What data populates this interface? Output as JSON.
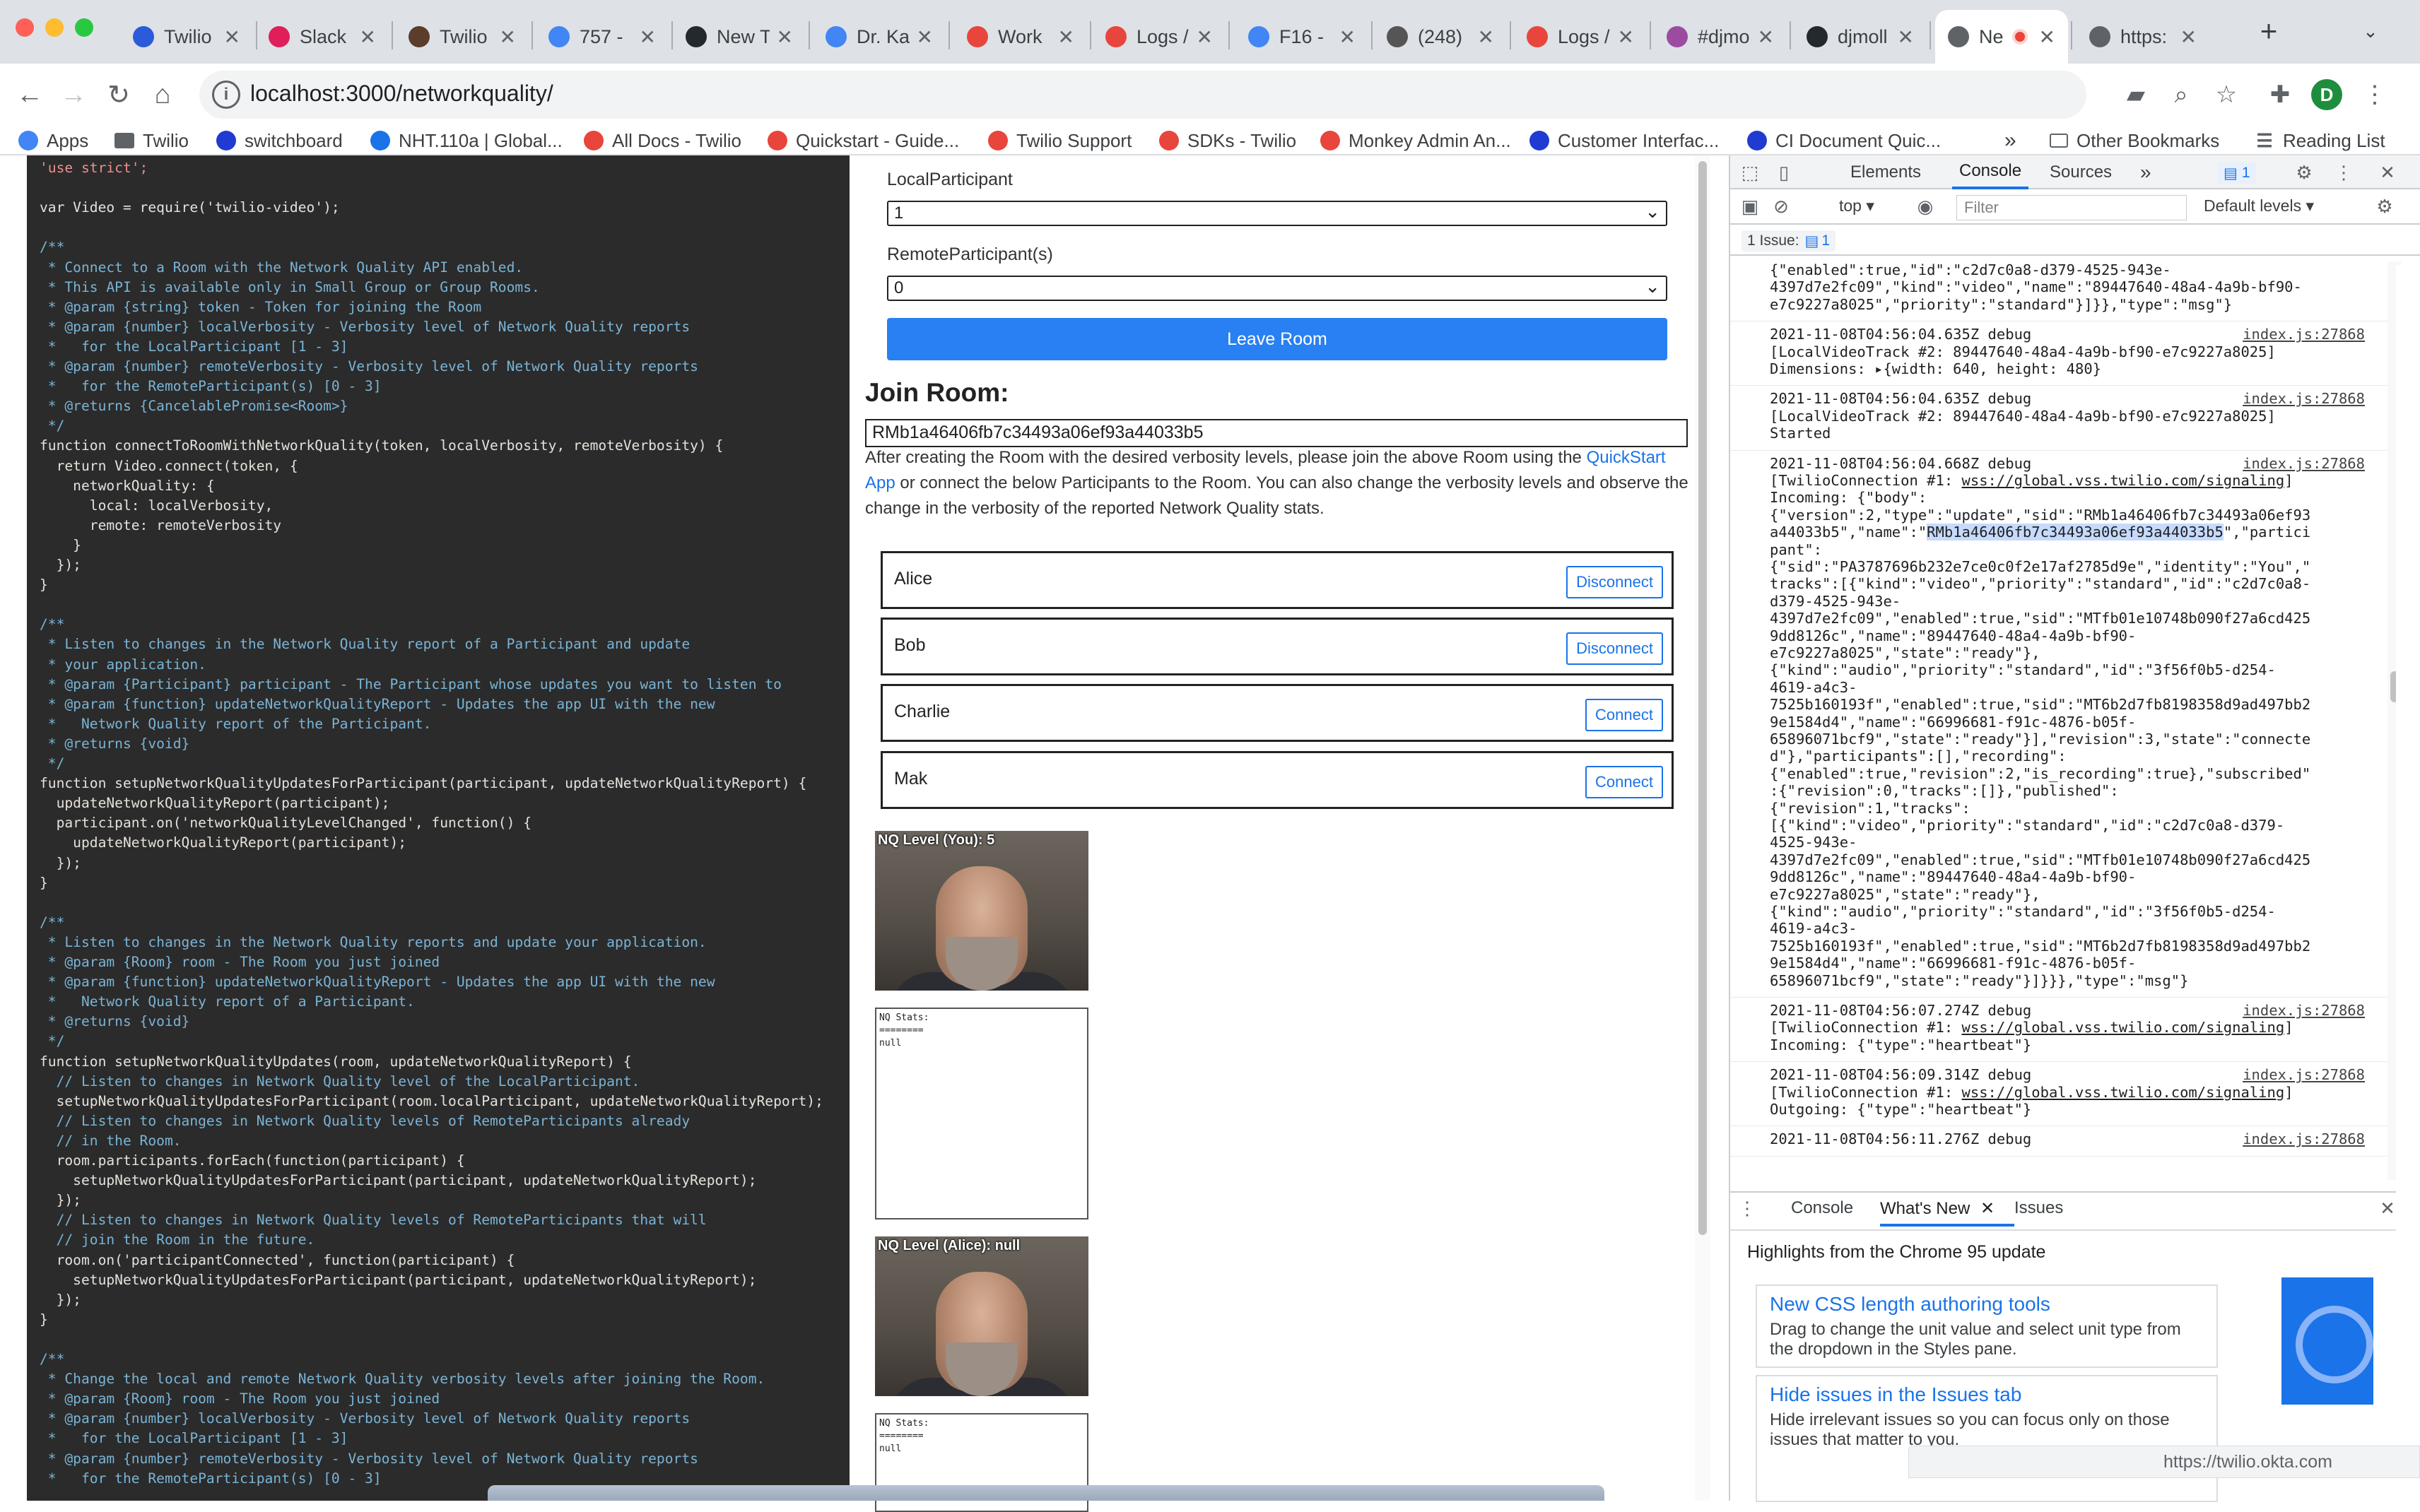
{
  "tabs": [
    {
      "label": "Twilio",
      "icon": "twilio-icon",
      "color": "#2b5bda"
    },
    {
      "label": "Slack",
      "icon": "slack-icon",
      "color": "#e01e5a"
    },
    {
      "label": "Twilio",
      "icon": "twilio-gnome-icon",
      "color": "#5a3d2b"
    },
    {
      "label": "757 -",
      "icon": "google-icon",
      "color": "#4285f4"
    },
    {
      "label": "New T",
      "icon": "github-icon",
      "color": "#24292e"
    },
    {
      "label": "Dr. Ka",
      "icon": "google-icon",
      "color": "#4285f4"
    },
    {
      "label": "Work",
      "icon": "monkey-icon",
      "color": "#e8453c"
    },
    {
      "label": "Logs /",
      "icon": "twilio-red-icon",
      "color": "#e8453c"
    },
    {
      "label": "F16 -",
      "icon": "google-icon",
      "color": "#4285f4"
    },
    {
      "label": "(248)",
      "icon": "speaker-icon",
      "color": "#555555"
    },
    {
      "label": "Logs /",
      "icon": "twilio-red-icon",
      "color": "#e8453c"
    },
    {
      "label": "#djmo",
      "icon": "slack-icon",
      "color": "#9c4ba0"
    },
    {
      "label": "djmoll",
      "icon": "github-icon",
      "color": "#24292e"
    },
    {
      "label": "Ne",
      "icon": "globe-icon",
      "color": "#5f6368"
    },
    {
      "label": "https:",
      "icon": "globe-icon",
      "color": "#5f6368"
    }
  ],
  "toolbar": {
    "url": "localhost:3000/networkquality/",
    "profile_initial": "D"
  },
  "bookmarks": [
    {
      "label": "Apps",
      "icon": "apps-grid-icon"
    },
    {
      "label": "Twilio",
      "icon": "folder-icon"
    },
    {
      "label": "switchboard",
      "icon": "twilio-icon"
    },
    {
      "label": "NHT.110a | Global...",
      "icon": "arrow-icon"
    },
    {
      "label": "All Docs - Twilio",
      "icon": "twilio-red-icon"
    },
    {
      "label": "Quickstart - Guide...",
      "icon": "twilio-red-icon"
    },
    {
      "label": "Twilio Support",
      "icon": "twilio-red-icon"
    },
    {
      "label": "SDKs - Twilio",
      "icon": "twilio-red-icon"
    },
    {
      "label": "Monkey Admin An...",
      "icon": "monkey-icon"
    },
    {
      "label": "Customer Interfac...",
      "icon": "twilio-icon"
    },
    {
      "label": "CI Document Quic...",
      "icon": "twilio-icon"
    }
  ],
  "bookmarks_overflow": "»",
  "bookmarks_right": [
    {
      "label": "Other Bookmarks",
      "icon": "folder-icon"
    },
    {
      "label": "Reading List",
      "icon": "reading-list-icon"
    }
  ],
  "code": [
    {
      "t": "'use strict';",
      "c": "st"
    },
    {
      "t": "",
      "c": ""
    },
    {
      "t": "var Video = require('twilio-video');",
      "c": "code"
    },
    {
      "t": "",
      "c": ""
    },
    {
      "t": "/**",
      "c": "cm"
    },
    {
      "t": " * Connect to a Room with the Network Quality API enabled.",
      "c": "cm"
    },
    {
      "t": " * This API is available only in Small Group or Group Rooms.",
      "c": "cm"
    },
    {
      "t": " * @param {string} token - Token for joining the Room",
      "c": "cm"
    },
    {
      "t": " * @param {number} localVerbosity - Verbosity level of Network Quality reports",
      "c": "cm"
    },
    {
      "t": " *   for the LocalParticipant [1 - 3]",
      "c": "cm"
    },
    {
      "t": " * @param {number} remoteVerbosity - Verbosity level of Network Quality reports",
      "c": "cm"
    },
    {
      "t": " *   for the RemoteParticipant(s) [0 - 3]",
      "c": "cm"
    },
    {
      "t": " * @returns {CancelablePromise<Room>}",
      "c": "cm"
    },
    {
      "t": " */",
      "c": "cm"
    },
    {
      "t": "function connectToRoomWithNetworkQuality(token, localVerbosity, remoteVerbosity) {",
      "c": "code"
    },
    {
      "t": "  return Video.connect(token, {",
      "c": "code"
    },
    {
      "t": "    networkQuality: {",
      "c": "code"
    },
    {
      "t": "      local: localVerbosity,",
      "c": "code"
    },
    {
      "t": "      remote: remoteVerbosity",
      "c": "code"
    },
    {
      "t": "    }",
      "c": "code"
    },
    {
      "t": "  });",
      "c": "code"
    },
    {
      "t": "}",
      "c": "code"
    },
    {
      "t": "",
      "c": ""
    },
    {
      "t": "/**",
      "c": "cm"
    },
    {
      "t": " * Listen to changes in the Network Quality report of a Participant and update",
      "c": "cm"
    },
    {
      "t": " * your application.",
      "c": "cm"
    },
    {
      "t": " * @param {Participant} participant - The Participant whose updates you want to listen to",
      "c": "cm"
    },
    {
      "t": " * @param {function} updateNetworkQualityReport - Updates the app UI with the new",
      "c": "cm"
    },
    {
      "t": " *   Network Quality report of the Participant.",
      "c": "cm"
    },
    {
      "t": " * @returns {void}",
      "c": "cm"
    },
    {
      "t": " */",
      "c": "cm"
    },
    {
      "t": "function setupNetworkQualityUpdatesForParticipant(participant, updateNetworkQualityReport) {",
      "c": "code"
    },
    {
      "t": "  updateNetworkQualityReport(participant);",
      "c": "code"
    },
    {
      "t": "  participant.on('networkQualityLevelChanged', function() {",
      "c": "code"
    },
    {
      "t": "    updateNetworkQualityReport(participant);",
      "c": "code"
    },
    {
      "t": "  });",
      "c": "code"
    },
    {
      "t": "}",
      "c": "code"
    },
    {
      "t": "",
      "c": ""
    },
    {
      "t": "/**",
      "c": "cm"
    },
    {
      "t": " * Listen to changes in the Network Quality reports and update your application.",
      "c": "cm"
    },
    {
      "t": " * @param {Room} room - The Room you just joined",
      "c": "cm"
    },
    {
      "t": " * @param {function} updateNetworkQualityReport - Updates the app UI with the new",
      "c": "cm"
    },
    {
      "t": " *   Network Quality report of a Participant.",
      "c": "cm"
    },
    {
      "t": " * @returns {void}",
      "c": "cm"
    },
    {
      "t": " */",
      "c": "cm"
    },
    {
      "t": "function setupNetworkQualityUpdates(room, updateNetworkQualityReport) {",
      "c": "code"
    },
    {
      "t": "  // Listen to changes in Network Quality level of the LocalParticipant.",
      "c": "cm"
    },
    {
      "t": "  setupNetworkQualityUpdatesForParticipant(room.localParticipant, updateNetworkQualityReport);",
      "c": "code"
    },
    {
      "t": "  // Listen to changes in Network Quality levels of RemoteParticipants already",
      "c": "cm"
    },
    {
      "t": "  // in the Room.",
      "c": "cm"
    },
    {
      "t": "  room.participants.forEach(function(participant) {",
      "c": "code"
    },
    {
      "t": "    setupNetworkQualityUpdatesForParticipant(participant, updateNetworkQualityReport);",
      "c": "code"
    },
    {
      "t": "  });",
      "c": "code"
    },
    {
      "t": "  // Listen to changes in Network Quality levels of RemoteParticipants that will",
      "c": "cm"
    },
    {
      "t": "  // join the Room in the future.",
      "c": "cm"
    },
    {
      "t": "  room.on('participantConnected', function(participant) {",
      "c": "code"
    },
    {
      "t": "    setupNetworkQualityUpdatesForParticipant(participant, updateNetworkQualityReport);",
      "c": "code"
    },
    {
      "t": "  });",
      "c": "code"
    },
    {
      "t": "}",
      "c": "code"
    },
    {
      "t": "",
      "c": ""
    },
    {
      "t": "/**",
      "c": "cm"
    },
    {
      "t": " * Change the local and remote Network Quality verbosity levels after joining the Room.",
      "c": "cm"
    },
    {
      "t": " * @param {Room} room - The Room you just joined",
      "c": "cm"
    },
    {
      "t": " * @param {number} localVerbosity - Verbosity level of Network Quality reports",
      "c": "cm"
    },
    {
      "t": " *   for the LocalParticipant [1 - 3]",
      "c": "cm"
    },
    {
      "t": " * @param {number} remoteVerbosity - Verbosity level of Network Quality reports",
      "c": "cm"
    },
    {
      "t": " *   for the RemoteParticipant(s) [0 - 3]",
      "c": "cm"
    }
  ],
  "page": {
    "local_label": "LocalParticipant",
    "local_value": "1",
    "remote_label": "RemoteParticipant(s)",
    "remote_value": "0",
    "leave_button": "Leave Room",
    "join_heading": "Join Room:",
    "room_input_value": "RMb1a46406fb7c34493a06ef93a44033b5",
    "instr_1": "After creating the Room with the desired verbosity levels, please join the above Room using the ",
    "instr_link": "QuickStart App",
    "instr_2": " or connect the below Participants to the Room. You can also change the verbosity levels and observe the change in the verbosity of the reported Network Quality stats.",
    "participants": [
      {
        "name": "Alice",
        "button": "Disconnect"
      },
      {
        "name": "Bob",
        "button": "Disconnect"
      },
      {
        "name": "Charlie",
        "button": "Connect"
      },
      {
        "name": "Mak",
        "button": "Connect"
      }
    ],
    "videos": [
      {
        "nq_label": "NQ Level (You): 5",
        "stats": "NQ Stats:\n========\nnull"
      },
      {
        "nq_label": "NQ Level (Alice): null",
        "stats": "NQ Stats:\n========\nnull"
      }
    ]
  },
  "devtools": {
    "tabs": [
      "Elements",
      "Console",
      "Sources"
    ],
    "active_tab": "Console",
    "more_tabs": "»",
    "issues_badge": "1",
    "context": "top",
    "filter_placeholder": "Filter",
    "levels": "Default levels",
    "issue_chip": "1 Issue:",
    "issue_chip_count": "1",
    "console_lines": [
      {
        "lines": [
          "{\"enabled\":true,\"id\":\"c2d7c0a8-d379-4525-943e-",
          "4397d7e2fc09\",\"kind\":\"video\",\"name\":\"89447640-48a4-4a9b-bf90-",
          "e7c9227a8025\",\"priority\":\"standard\"}]}},\"type\":\"msg\"}"
        ],
        "src": ""
      },
      {
        "lines": [
          "2021-11-08T04:56:04.635Z debug",
          "[LocalVideoTrack #2: 89447640-48a4-4a9b-bf90-e7c9227a8025]",
          "Dimensions: ▸{width: 640, height: 480}"
        ],
        "src": "index.js:27868"
      },
      {
        "lines": [
          "2021-11-08T04:56:04.635Z debug",
          "[LocalVideoTrack #2: 89447640-48a4-4a9b-bf90-e7c9227a8025]",
          "Started"
        ],
        "src": "index.js:27868"
      },
      {
        "lines": [
          "2021-11-08T04:56:04.668Z debug",
          "[TwilioConnection #1: wss://global.vss.twilio.com/signaling]",
          "Incoming: {\"body\":",
          "{\"version\":2,\"type\":\"update\",\"sid\":\"RMb1a46406fb7c34493a06ef93",
          "a44033b5\",\"name\":\"RMb1a46406fb7c34493a06ef93a44033b5\",\"partici",
          "pant\":",
          "{\"sid\":\"PA3787696b232e7ce0c0f2e17af2785d9e\",\"identity\":\"You\",\"",
          "tracks\":[{\"kind\":\"video\",\"priority\":\"standard\",\"id\":\"c2d7c0a8-",
          "d379-4525-943e-",
          "4397d7e2fc09\",\"enabled\":true,\"sid\":\"MTfb01e10748b090f27a6cd425",
          "9dd8126c\",\"name\":\"89447640-48a4-4a9b-bf90-",
          "e7c9227a8025\",\"state\":\"ready\"},",
          "{\"kind\":\"audio\",\"priority\":\"standard\",\"id\":\"3f56f0b5-d254-",
          "4619-a4c3-",
          "7525b160193f\",\"enabled\":true,\"sid\":\"MT6b2d7fb8198358d9ad497bb2",
          "9e1584d4\",\"name\":\"66996681-f91c-4876-b05f-",
          "65896071bcf9\",\"state\":\"ready\"}],\"revision\":3,\"state\":\"connecte",
          "d\"},\"participants\":[],\"recording\":",
          "{\"enabled\":true,\"revision\":2,\"is_recording\":true},\"subscribed\"",
          ":{\"revision\":0,\"tracks\":[]},\"published\":",
          "{\"revision\":1,\"tracks\":",
          "[{\"kind\":\"video\",\"priority\":\"standard\",\"id\":\"c2d7c0a8-d379-",
          "4525-943e-",
          "4397d7e2fc09\",\"enabled\":true,\"sid\":\"MTfb01e10748b090f27a6cd425",
          "9dd8126c\",\"name\":\"89447640-48a4-4a9b-bf90-",
          "e7c9227a8025\",\"state\":\"ready\"},",
          "{\"kind\":\"audio\",\"priority\":\"standard\",\"id\":\"3f56f0b5-d254-",
          "4619-a4c3-",
          "7525b160193f\",\"enabled\":true,\"sid\":\"MT6b2d7fb8198358d9ad497bb2",
          "9e1584d4\",\"name\":\"66996681-f91c-4876-b05f-",
          "65896071bcf9\",\"state\":\"ready\"}]}}},\"type\":\"msg\"}"
        ],
        "src": "index.js:27868"
      },
      {
        "lines": [
          "2021-11-08T04:56:07.274Z debug",
          "[TwilioConnection #1: wss://global.vss.twilio.com/signaling]",
          "Incoming: {\"type\":\"heartbeat\"}"
        ],
        "src": "index.js:27868"
      },
      {
        "lines": [
          "2021-11-08T04:56:09.314Z debug",
          "[TwilioConnection #1: wss://global.vss.twilio.com/signaling]",
          "Outgoing: {\"type\":\"heartbeat\"}"
        ],
        "src": "index.js:27868"
      },
      {
        "lines": [
          "2021-11-08T04:56:11.276Z debug"
        ],
        "src": "index.js:27868"
      }
    ],
    "drawer_tabs": [
      "Console",
      "What's New",
      "Issues"
    ],
    "drawer_active": "What's New",
    "drawer_heading": "Highlights from the Chrome 95 update",
    "cards": [
      {
        "title": "New CSS length authoring tools",
        "desc": "Drag to change the unit value and select unit type from the dropdown in the Styles pane."
      },
      {
        "title": "Hide issues in the Issues tab",
        "desc": "Hide irrelevant issues so you can focus only on those issues that matter to you."
      }
    ]
  },
  "status_url": "https://twilio.okta.com",
  "colors": {
    "accent": "#2980f2",
    "link": "#1a73e8",
    "code_bg": "#2b2b2b"
  }
}
